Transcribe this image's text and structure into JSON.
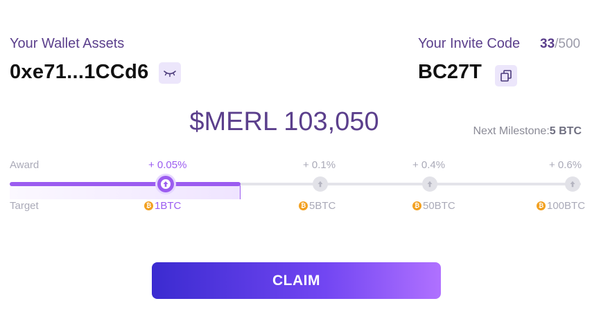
{
  "wallet": {
    "label": "Your Wallet Assets",
    "address": "0xe71...1CCd6"
  },
  "invite": {
    "label": "Your Invite Code",
    "used": "33",
    "separator": "/",
    "max": "500",
    "code": "BC27T"
  },
  "balance": {
    "text": "$MERL 103,050"
  },
  "milestone": {
    "label": "Next Milestone:",
    "value": "5 BTC"
  },
  "progress": {
    "award_label": "Award",
    "target_label": "Target",
    "levels": [
      {
        "award": "+ 0.05%",
        "target": "1BTC",
        "reached": true
      },
      {
        "award": "+ 0.1%",
        "target": "5BTC",
        "reached": false
      },
      {
        "award": "+ 0.4%",
        "target": "50BTC",
        "reached": false
      },
      {
        "award": "+ 0.6%",
        "target": "100BTC",
        "reached": false
      }
    ]
  },
  "actions": {
    "claim_label": "CLAIM"
  },
  "colors": {
    "accent": "#9b5cf0",
    "label_purple": "#5b3f8c",
    "coin": "#f2a020"
  },
  "icons": {
    "eye": "eye-closed-icon",
    "copy": "copy-icon",
    "arrow": "arrow-up-icon",
    "coin": "bitcoin-icon"
  }
}
